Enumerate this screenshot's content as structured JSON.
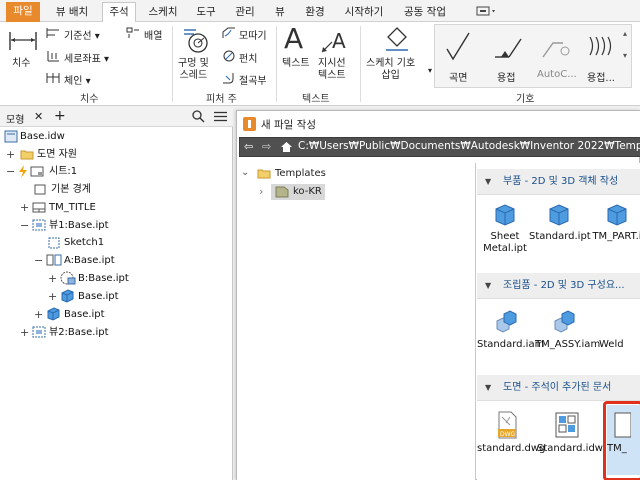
{
  "tabs": [
    {
      "label": "파일"
    },
    {
      "label": "뷰 배치"
    },
    {
      "label": "주석"
    },
    {
      "label": "스케치"
    },
    {
      "label": "도구"
    },
    {
      "label": "관리"
    },
    {
      "label": "뷰"
    },
    {
      "label": "환경"
    },
    {
      "label": "시작하기"
    },
    {
      "label": "공동 작업"
    }
  ],
  "ribbon": {
    "dimension": {
      "big_label": "치수",
      "items": [
        "기준선",
        "세로좌표",
        "체인",
        "배열"
      ],
      "panel_label": "치수"
    },
    "feature_notes": {
      "hole_thread": "구멍 및\n스레드",
      "items": [
        "모따기",
        "펀치",
        "절곡부"
      ],
      "panel_label": "피처 주"
    },
    "text": {
      "text_label": "텍스트",
      "leader_label": "지시선\n텍스트",
      "panel_label": "텍스트"
    },
    "symbols": {
      "sketch_symbol": "스케치 기호\n삽입",
      "gallery": [
        "곡면",
        "용접",
        "AutoC...",
        "용접..."
      ],
      "panel_label": "기호"
    }
  },
  "browser": {
    "tab_label": "모형",
    "close_glyph": "✕",
    "add_glyph": "+",
    "tree": [
      {
        "label": "Base.idw",
        "toggle": ""
      },
      {
        "label": "도면 자원",
        "toggle": "+"
      },
      {
        "label": "시트:1",
        "toggle": "−"
      },
      {
        "label": "기본 경계",
        "toggle": ""
      },
      {
        "label": "TM_TITLE",
        "toggle": "+"
      },
      {
        "label": "뷰1:Base.ipt",
        "toggle": "−"
      },
      {
        "label": "Sketch1",
        "toggle": ""
      },
      {
        "label": "A:Base.ipt",
        "toggle": "−"
      },
      {
        "label": "B:Base.ipt",
        "toggle": "+"
      },
      {
        "label": "Base.ipt",
        "toggle": "+"
      },
      {
        "label": "Base.ipt",
        "toggle": "+"
      },
      {
        "label": "뷰2:Base.ipt",
        "toggle": "+"
      }
    ]
  },
  "dialog": {
    "title": "새 파일 작성",
    "path": "C:₩Users₩Public₩Documents₩Autodesk₩Inventor 2022₩Templates",
    "folders": [
      {
        "label": "Templates",
        "toggle": "⌄"
      },
      {
        "label": "ko-KR",
        "toggle": "›"
      }
    ],
    "sections": [
      {
        "header": "부품 - 2D 및 3D 객체 작성",
        "files": [
          "Sheet\nMetal.ipt",
          "Standard.ipt",
          "TM_PART.i"
        ]
      },
      {
        "header": "조립품 - 2D 및 3D 구성요...",
        "files": [
          "Standard.iam",
          "TM_ASSY.iam",
          "Weld"
        ]
      },
      {
        "header": "도면 - 주석이 추가된 문서",
        "files": [
          "standard.dwg",
          "Standard.idw",
          "TM_"
        ]
      }
    ]
  },
  "colors": {
    "file_tab": "#e8892b",
    "highlight": "#e0311f",
    "accent": "#1a4f8a"
  }
}
